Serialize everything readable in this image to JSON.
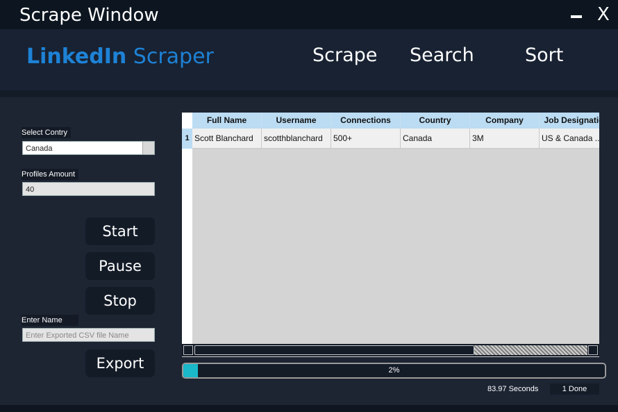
{
  "window": {
    "title": "Scrape Window",
    "close_label": "X"
  },
  "header": {
    "brand_bold": "LinkedIn",
    "brand_light": "Scraper",
    "nav": {
      "scrape": "Scrape",
      "search": "Search",
      "sort": "Sort"
    }
  },
  "form": {
    "country_label": "Select Contry",
    "country_value": "Canada",
    "profiles_label": "Profiles Amount",
    "profiles_value": "40",
    "name_label": "Enter Name",
    "name_placeholder": "Enter Exported CSV file Name"
  },
  "buttons": {
    "start": "Start",
    "pause": "Pause",
    "stop": "Stop",
    "export": "Export"
  },
  "table": {
    "columns": [
      "Full Name",
      "Username",
      "Connections",
      "Country",
      "Company",
      "Job Designatio"
    ],
    "rows": [
      {
        "index": "1",
        "cells": [
          "Scott Blanchard",
          "scotthblanchard",
          "500+",
          "Canada",
          "3M",
          "US & Canada ..."
        ]
      }
    ]
  },
  "progress": {
    "value": 0.02,
    "label": "2%"
  },
  "status": {
    "elapsed": "83.97 Seconds",
    "done": "1 Done"
  },
  "colors": {
    "brand": "#1e82d6",
    "progress_fill": "#1ab8c9",
    "header_cell": "#bbdcf3"
  }
}
